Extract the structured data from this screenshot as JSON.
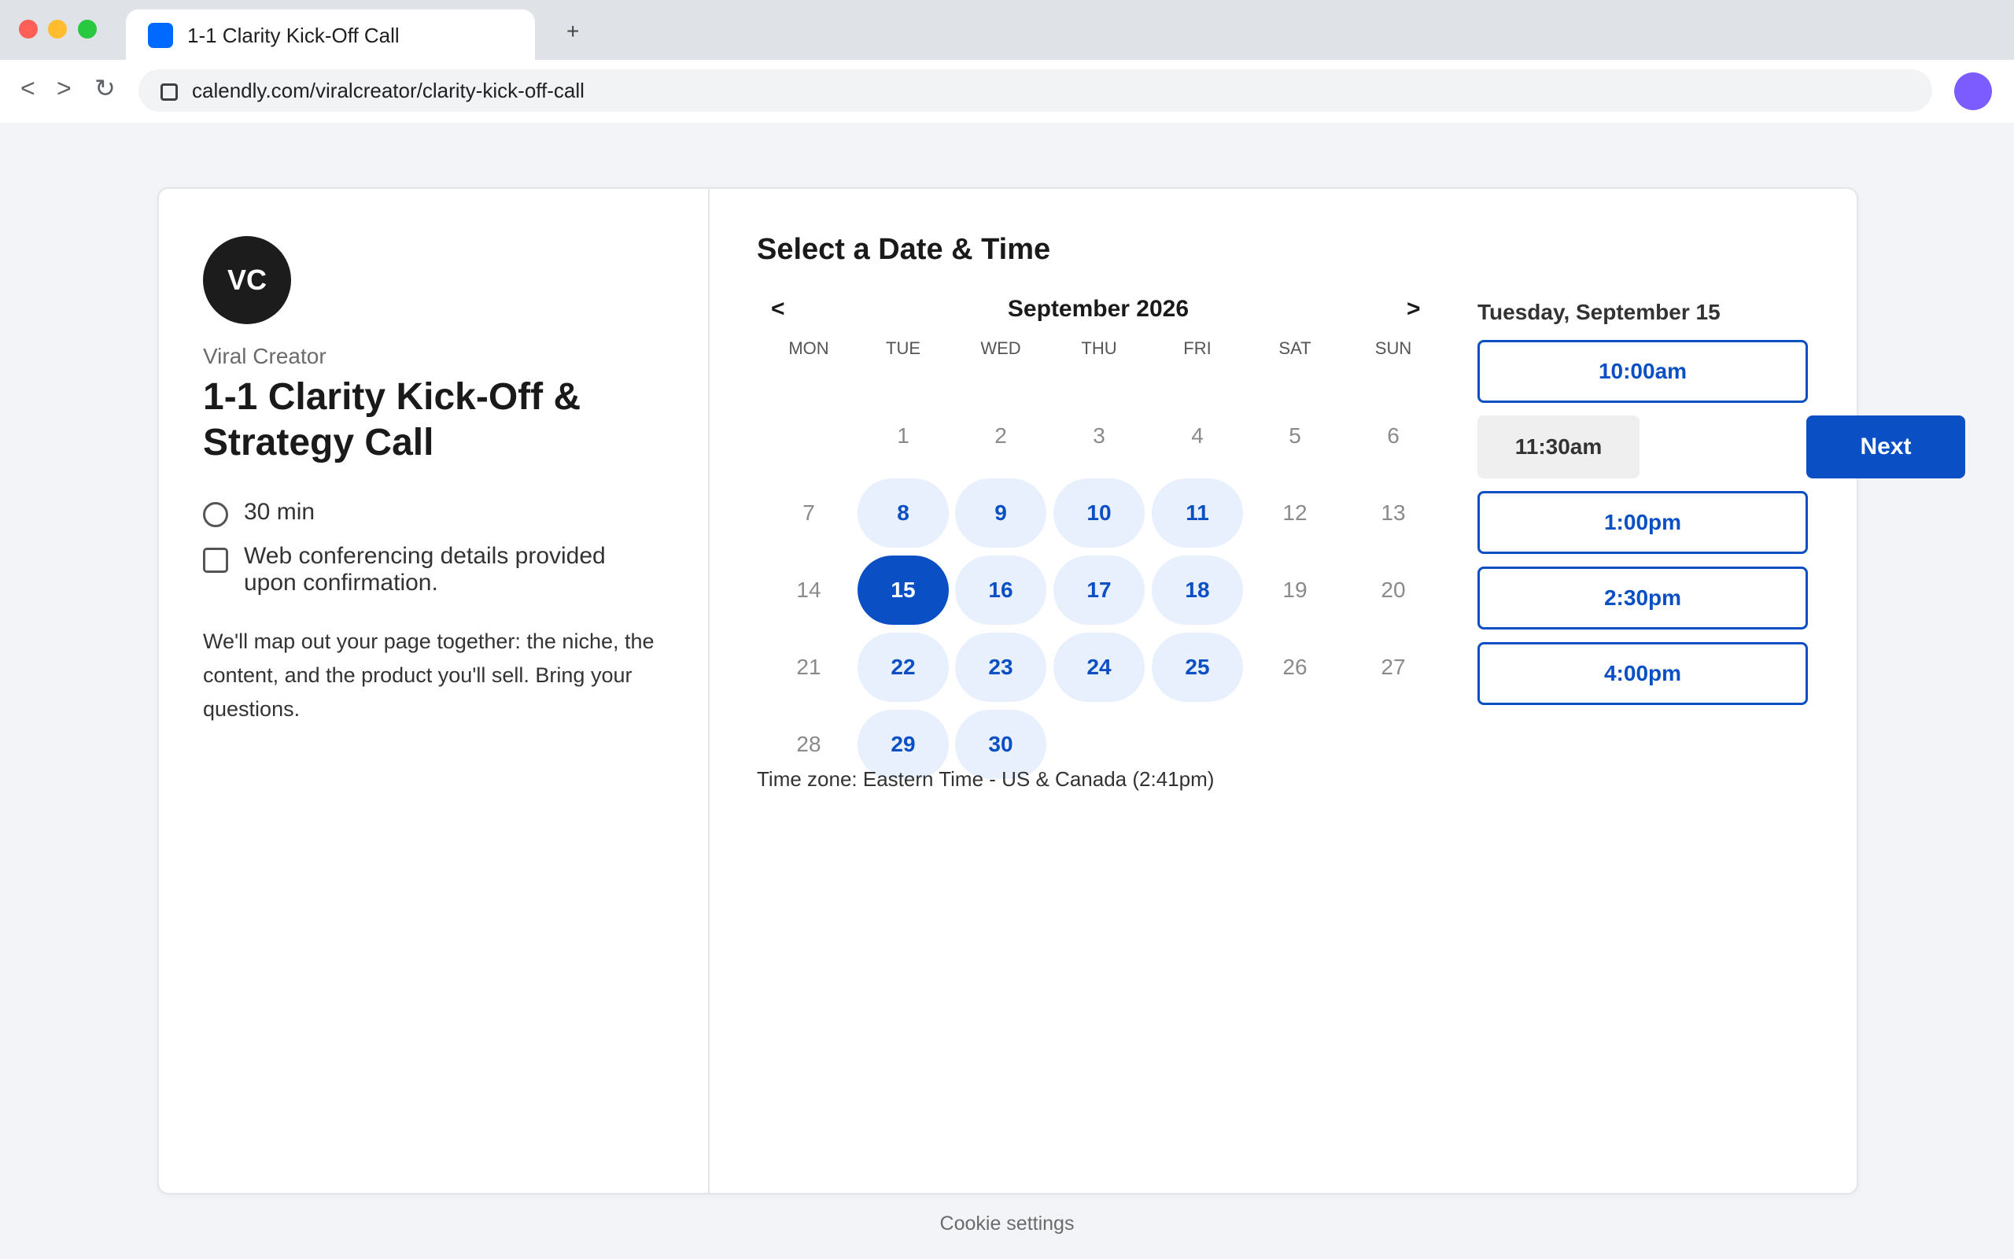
{
  "browser": {
    "tab_title": "1-1 Clarity Kick-Off Call",
    "new_tab": "+",
    "nav_back": "<",
    "nav_forward": ">",
    "nav_reload": "↻",
    "url": "calendly.com/viralcreator/clarity-kick-off-call"
  },
  "host": {
    "initials": "VC",
    "name": "Viral Creator"
  },
  "event": {
    "title": "1-1 Clarity Kick-Off & Strategy Call",
    "duration": "30 min",
    "conferencing": "Web conferencing details provided upon confirmation.",
    "description": "We'll map out your page together: the niche, the content, and the product you'll sell. Bring your questions."
  },
  "scheduler": {
    "title": "Select a Date & Time",
    "prev": "<",
    "next": ">",
    "month": "September 2026",
    "weekdays": [
      "MON",
      "TUE",
      "WED",
      "THU",
      "FRI",
      "SAT",
      "SUN"
    ],
    "weeks": [
      [
        null,
        {
          "day": "1",
          "state": "unavailable"
        },
        {
          "day": "2",
          "state": "unavailable"
        },
        {
          "day": "3",
          "state": "unavailable"
        },
        {
          "day": "4",
          "state": "unavailable"
        },
        {
          "day": "5",
          "state": "unavailable"
        },
        {
          "day": "6",
          "state": "unavailable"
        }
      ],
      [
        {
          "day": "7",
          "state": "unavailable"
        },
        {
          "day": "8",
          "state": "available"
        },
        {
          "day": "9",
          "state": "available"
        },
        {
          "day": "10",
          "state": "available"
        },
        {
          "day": "11",
          "state": "available"
        },
        {
          "day": "12",
          "state": "unavailable"
        },
        {
          "day": "13",
          "state": "unavailable"
        }
      ],
      [
        {
          "day": "14",
          "state": "unavailable"
        },
        {
          "day": "15",
          "state": "selected"
        },
        {
          "day": "16",
          "state": "available"
        },
        {
          "day": "17",
          "state": "available"
        },
        {
          "day": "18",
          "state": "available"
        },
        {
          "day": "19",
          "state": "unavailable"
        },
        {
          "day": "20",
          "state": "unavailable"
        }
      ],
      [
        {
          "day": "21",
          "state": "unavailable"
        },
        {
          "day": "22",
          "state": "available"
        },
        {
          "day": "23",
          "state": "available"
        },
        {
          "day": "24",
          "state": "available"
        },
        {
          "day": "25",
          "state": "available"
        },
        {
          "day": "26",
          "state": "unavailable"
        },
        {
          "day": "27",
          "state": "unavailable"
        }
      ],
      [
        {
          "day": "28",
          "state": "unavailable"
        },
        {
          "day": "29",
          "state": "available"
        },
        {
          "day": "30",
          "state": "available"
        },
        null,
        null,
        null,
        null
      ]
    ],
    "timezone": "Time zone: Eastern Time - US & Canada (2:41pm)",
    "selected_date": "Tuesday, September 15",
    "slots": [
      "10:00am",
      "11:30am",
      "1:00pm",
      "2:30pm",
      "4:00pm"
    ],
    "selected_slot": "11:30am",
    "next_label": "Next"
  },
  "footer": {
    "cookie": "Cookie settings"
  },
  "colors": {
    "accent": "#0b4fc4",
    "available_bg": "#e8effd",
    "favicon": "#0069ff",
    "profile": "#7c5cff"
  }
}
